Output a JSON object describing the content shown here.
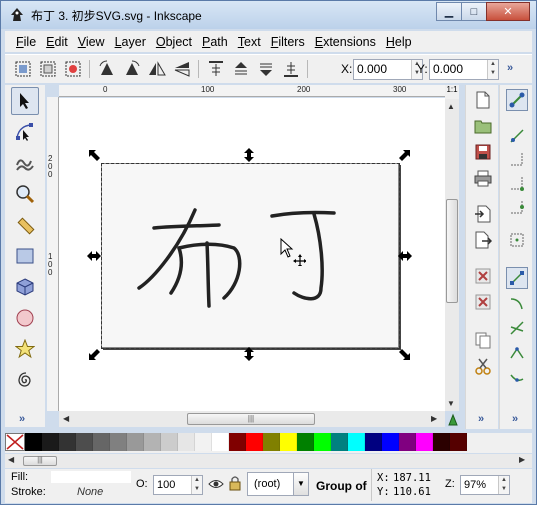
{
  "window": {
    "title": "布丁 3. 初步SVG.svg - Inkscape",
    "minimize_glyph": "▁",
    "maximize_glyph": "□",
    "close_glyph": "✕"
  },
  "menu": [
    "File",
    "Edit",
    "View",
    "Layer",
    "Object",
    "Path",
    "Text",
    "Filters",
    "Extensions",
    "Help"
  ],
  "toolbar": {
    "x_label": "X:",
    "x_value": "0.000",
    "y_label": "Y:",
    "y_value": "0.000",
    "more": "»"
  },
  "ruler": {
    "top_ticks": [
      "0",
      "100",
      "200",
      "300"
    ],
    "left_ticks": [
      "2",
      "0",
      "0",
      "1",
      "0",
      "0"
    ],
    "corner": "1:1"
  },
  "tools": [
    "selector-tool",
    "node-tool",
    "tweak-tool",
    "zoom-tool",
    "measure-tool",
    "rect-tool",
    "3dbox-tool",
    "ellipse-tool",
    "star-tool",
    "spiral-tool"
  ],
  "toolbox_more": "»",
  "right_more": "»",
  "palette": {
    "colors": [
      "#000000",
      "#1a1a1a",
      "#333333",
      "#4d4d4d",
      "#666666",
      "#808080",
      "#999999",
      "#b3b3b3",
      "#cccccc",
      "#e6e6e6",
      "#f2f2f2",
      "#ffffff",
      "#800000",
      "#ff0000",
      "#808000",
      "#ffff00",
      "#008000",
      "#00ff00",
      "#008080",
      "#00ffff",
      "#000080",
      "#0000ff",
      "#800080",
      "#ff00ff",
      "#2b0000",
      "#550000"
    ]
  },
  "status": {
    "fill_label": "Fill:",
    "stroke_label": "Stroke:",
    "stroke_value": "None",
    "opacity_label": "O:",
    "opacity_value": "100",
    "layer_value": "(root)",
    "layer_arrow": "▼",
    "message": "Group of",
    "x_label": "X:",
    "x_value": "187.11",
    "y_label": "Y:",
    "y_value": "110.61",
    "zoom_label": "Z:",
    "zoom_value": "97%"
  }
}
